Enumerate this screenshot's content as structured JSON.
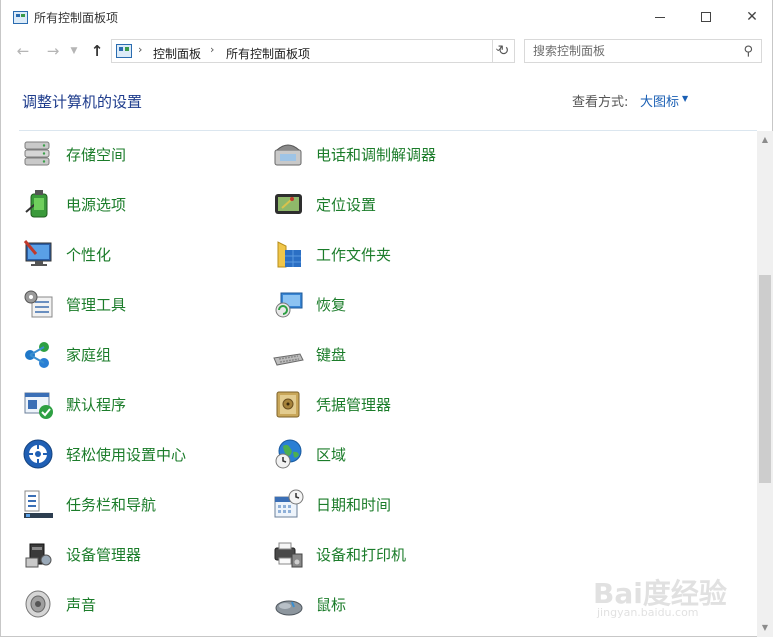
{
  "window": {
    "title": "所有控制面板项"
  },
  "titlebar_buttons": [
    "minimize",
    "maximize",
    "close"
  ],
  "nav": {
    "back_icon": "arrow-left-icon",
    "forward_icon": "arrow-right-icon",
    "recent_icon": "chevron-down-icon",
    "up_icon": "arrow-up-icon"
  },
  "address_bar": {
    "icon": "control-panel-icon",
    "crumbs": [
      "控制面板",
      "所有控制面板项"
    ]
  },
  "search": {
    "placeholder": "搜索控制面板"
  },
  "header": {
    "title": "调整计算机的设置",
    "view_by_label": "查看方式:",
    "view_by_value": "大图标"
  },
  "items_left": [
    {
      "label": "存储空间",
      "icon": "storage-spaces-icon"
    },
    {
      "label": "电源选项",
      "icon": "power-options-icon"
    },
    {
      "label": "个性化",
      "icon": "personalization-icon"
    },
    {
      "label": "管理工具",
      "icon": "administrative-tools-icon"
    },
    {
      "label": "家庭组",
      "icon": "homegroup-icon"
    },
    {
      "label": "默认程序",
      "icon": "default-programs-icon"
    },
    {
      "label": "轻松使用设置中心",
      "icon": "ease-of-access-icon"
    },
    {
      "label": "任务栏和导航",
      "icon": "taskbar-icon"
    },
    {
      "label": "设备管理器",
      "icon": "device-manager-icon"
    },
    {
      "label": "声音",
      "icon": "sound-icon"
    }
  ],
  "items_right": [
    {
      "label": "电话和调制解调器",
      "icon": "phone-modem-icon"
    },
    {
      "label": "定位设置",
      "icon": "location-settings-icon"
    },
    {
      "label": "工作文件夹",
      "icon": "work-folders-icon"
    },
    {
      "label": "恢复",
      "icon": "recovery-icon"
    },
    {
      "label": "键盘",
      "icon": "keyboard-icon"
    },
    {
      "label": "凭据管理器",
      "icon": "credential-manager-icon"
    },
    {
      "label": "区域",
      "icon": "region-icon"
    },
    {
      "label": "日期和时间",
      "icon": "date-time-icon"
    },
    {
      "label": "设备和打印机",
      "icon": "devices-printers-icon"
    },
    {
      "label": "鼠标",
      "icon": "mouse-icon"
    }
  ],
  "watermark": {
    "main": "Bai度经验",
    "sub": "jingyan.baidu.com"
  },
  "colors": {
    "item_link": "#1b7c2a",
    "page_title": "#1e3c8c",
    "view_by_link": "#1a5fb4"
  }
}
